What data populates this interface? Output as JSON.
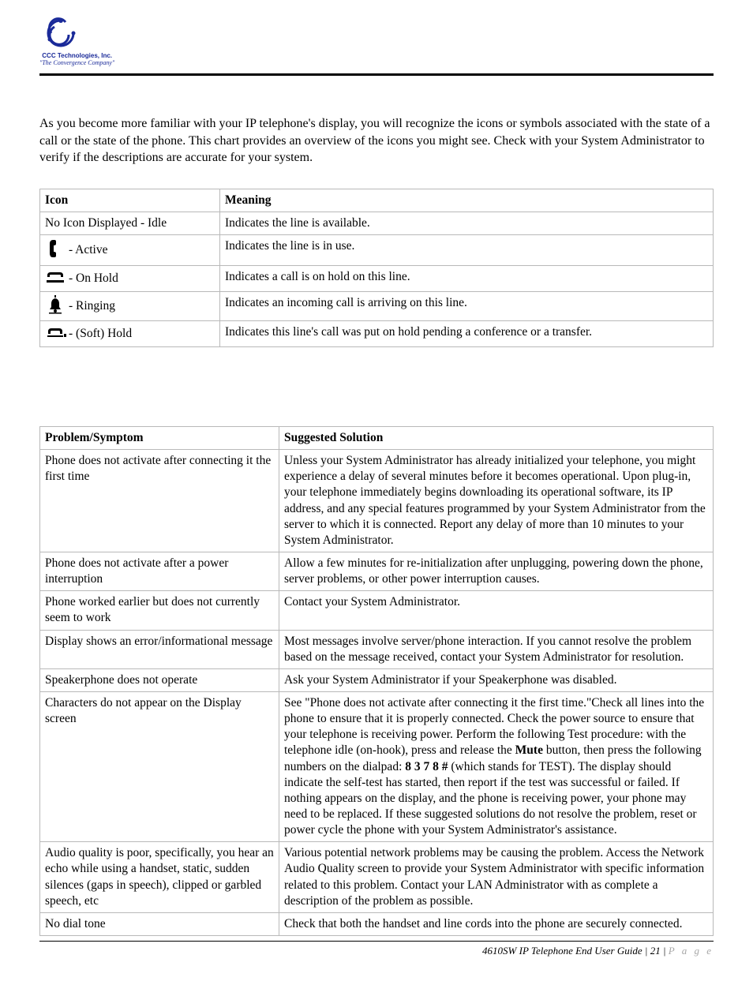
{
  "logo": {
    "brand": "CCC Technologies, Inc.",
    "tagline": "\"The Convergence Company\""
  },
  "intro": "As you become more familiar with your IP telephone's display, you will recognize the icons or symbols associated with the state of a call or the state of the phone. This chart provides an overview of the icons you might see. Check with your System Administrator to verify if the descriptions are accurate for your system.",
  "icon_table": {
    "headers": [
      "Icon",
      "Meaning"
    ],
    "rows": [
      {
        "icon_label": "No Icon Displayed - Idle",
        "glyph": "",
        "suffix": "",
        "meaning": "Indicates the line is available."
      },
      {
        "icon_label": "Active",
        "glyph": "handset",
        "suffix": "- ",
        "meaning": "Indicates the line is in use."
      },
      {
        "icon_label": "On Hold",
        "glyph": "hold",
        "suffix": "- ",
        "meaning": "Indicates a call is on hold on this line."
      },
      {
        "icon_label": "Ringing",
        "glyph": "bell",
        "suffix": "- ",
        "meaning": "Indicates an incoming call is arriving on this line."
      },
      {
        "icon_label": "(Soft) Hold",
        "glyph": "softhold",
        "suffix": "- ",
        "meaning": "Indicates this line's call was put on hold pending a conference or a transfer."
      }
    ]
  },
  "trouble_table": {
    "headers": [
      "Problem/Symptom",
      "Suggested Solution"
    ],
    "rows": [
      {
        "problem": "Phone does not activate after connecting it the first time",
        "solution": "Unless your System Administrator has already initialized your telephone, you might experience a delay of several minutes before it becomes operational. Upon plug-in, your telephone immediately begins downloading its operational software, its IP address, and any special features programmed by your System Administrator from the server to which it is connected. Report any delay of more than 10 minutes to your System Administrator."
      },
      {
        "problem": "Phone does not activate after a power interruption",
        "solution": "Allow a few minutes for re-initialization after unplugging, powering down the phone, server problems, or other power interruption causes."
      },
      {
        "problem": "Phone worked earlier but does not currently seem to work",
        "solution": "Contact your System Administrator."
      },
      {
        "problem": "Display shows an error/informational message",
        "solution": "Most messages involve server/phone interaction. If you cannot resolve the problem based on the message received, contact your System Administrator for resolution."
      },
      {
        "problem": "Speakerphone does not operate",
        "solution": "Ask your System Administrator if your Speakerphone was disabled."
      },
      {
        "problem": "Characters do not appear on the Display screen",
        "solution_pre": "See \"Phone does not activate after connecting it the first time.\"Check all lines into the phone to ensure that it is properly connected. Check the power source to ensure that your telephone is receiving power. Perform the following Test procedure: with the telephone idle (on-hook), press and release the ",
        "solution_mute": "Mute",
        "solution_mid": " button, then press the following numbers on the dialpad: ",
        "solution_seq": "8 3 7 8 #",
        "solution_post": " (which stands for TEST). The display should indicate the self-test has started, then report if the test was successful or failed. If nothing appears on the display, and the phone is receiving power, your phone may need to be replaced. If these suggested solutions do not resolve the problem, reset or power cycle the phone with your System Administrator's assistance."
      },
      {
        "problem": "Audio quality is poor, specifically, you hear an echo while using a handset, static, sudden silences (gaps in speech), clipped or garbled speech, etc",
        "solution": "Various potential network problems may be causing the problem. Access the Network Audio Quality screen to provide your System Administrator with specific information related to this problem. Contact your LAN Administrator with as complete a description of the problem as possible."
      },
      {
        "problem": "No dial tone",
        "solution": "Check that both the handset and line cords into the phone are securely connected."
      }
    ]
  },
  "footer": {
    "title": "4610SW IP Telephone End User Guide",
    "page_num": "21",
    "page_word": "P a g e"
  }
}
